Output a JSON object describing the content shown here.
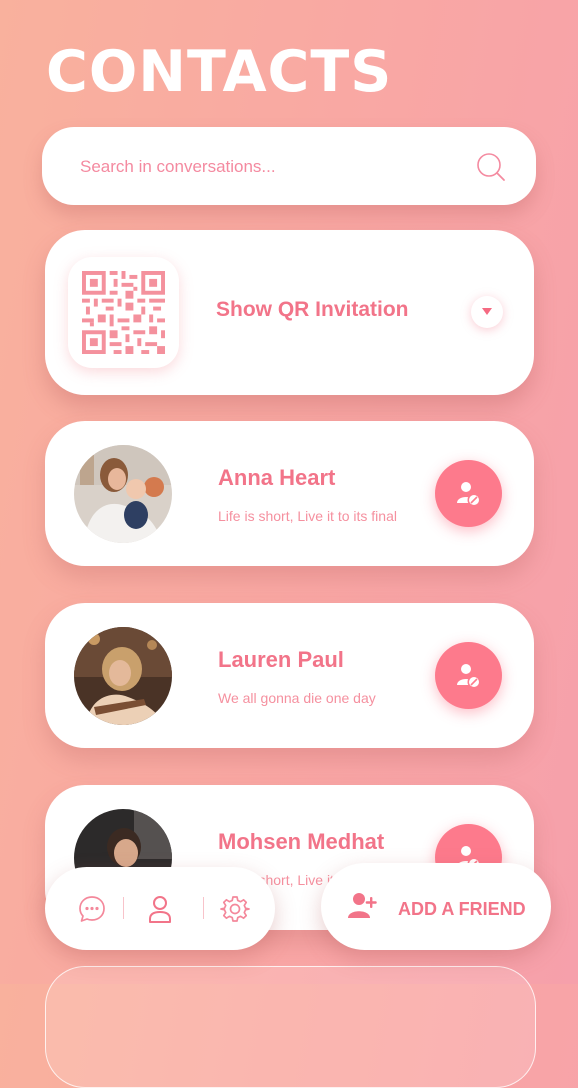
{
  "page": {
    "title": "CONTACTS"
  },
  "search": {
    "placeholder": "Search in conversations..."
  },
  "qr": {
    "label": "Show QR Invitation"
  },
  "contacts": [
    {
      "name": "Anna Heart",
      "status": "Life is short, Live it to its final"
    },
    {
      "name": "Lauren Paul",
      "status": "We all gonna die one day"
    },
    {
      "name": "Mohsen Medhat",
      "status": "Life is short, Live it to its final"
    }
  ],
  "bottom_nav": {
    "items": [
      {
        "icon": "chat-bubble-icon"
      },
      {
        "icon": "user-profile-icon"
      },
      {
        "icon": "gear-icon"
      }
    ]
  },
  "add_friend": {
    "label": "ADD A FRIEND",
    "icon": "add-user-icon"
  },
  "colors": {
    "accent": "#f27489",
    "accent_fill": "#fd7a8c",
    "background_start": "#f9b19d",
    "background_end": "#f6a0ab"
  }
}
